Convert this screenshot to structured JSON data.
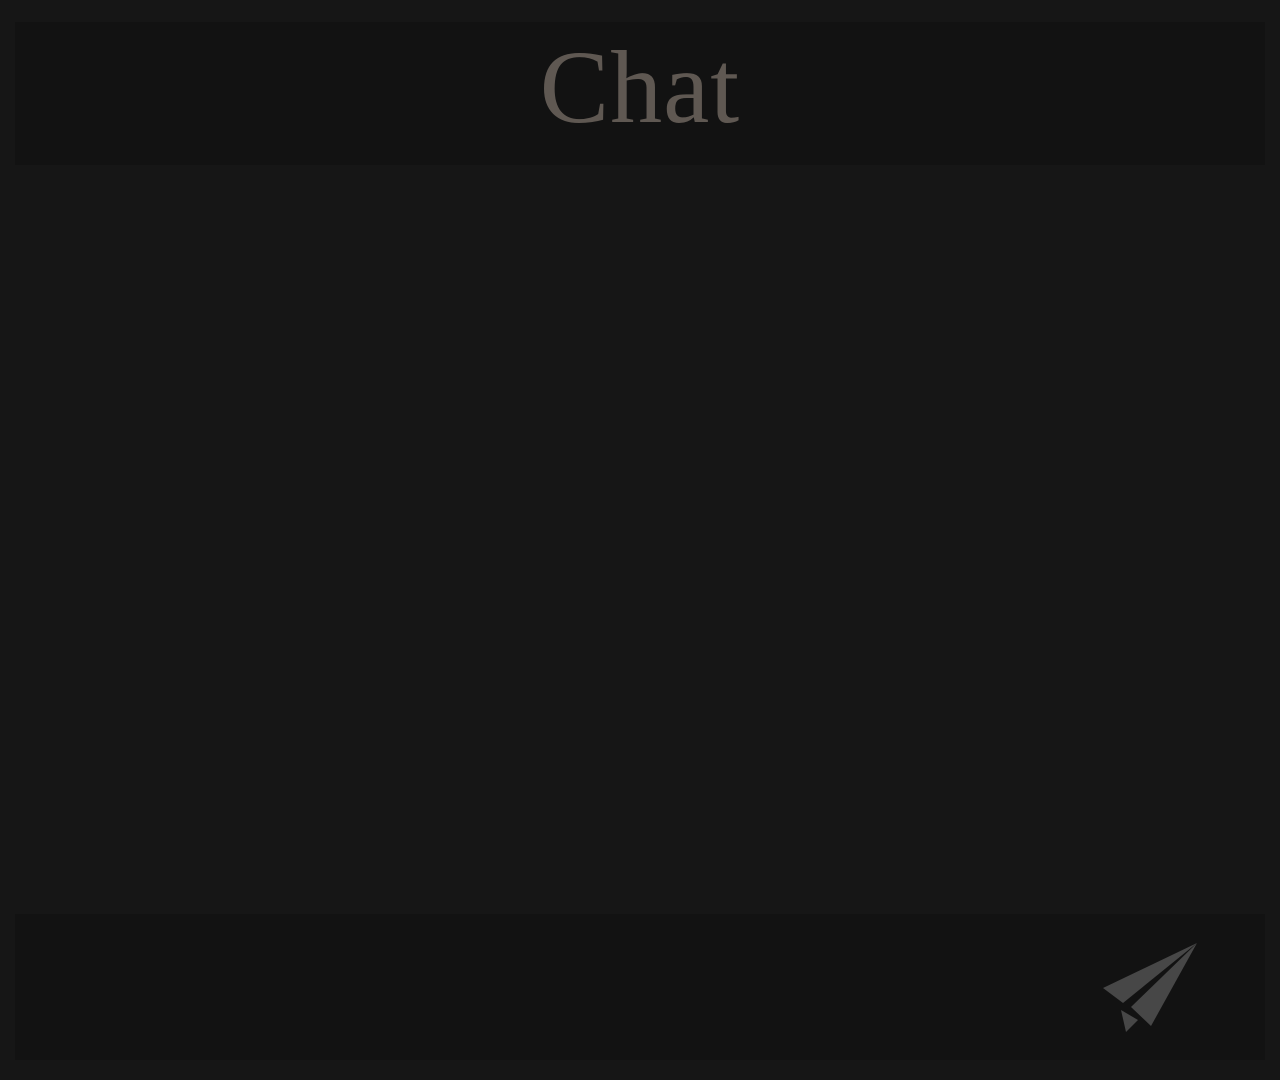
{
  "header": {
    "title": "Chat"
  },
  "composer": {
    "placeholder": "",
    "value": "",
    "send_icon": "paper-plane-icon"
  },
  "colors": {
    "background": "#161616",
    "panel": "#121212",
    "title": "#5f5852",
    "icon": "#474747"
  }
}
